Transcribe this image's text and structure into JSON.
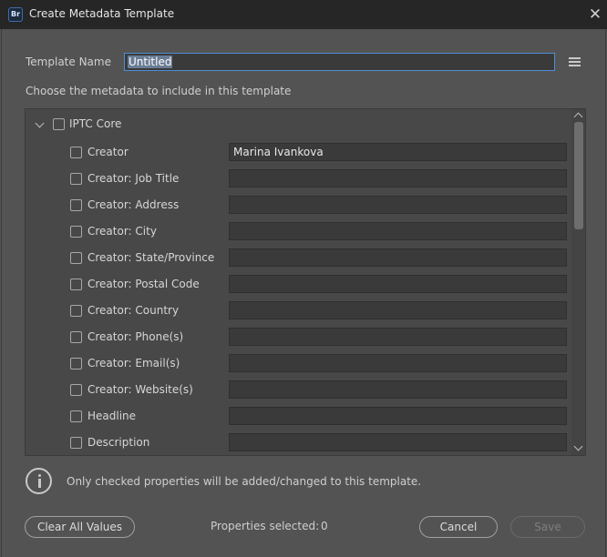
{
  "window": {
    "app_icon_text": "Br",
    "title": "Create Metadata Template",
    "close_icon": "close-icon"
  },
  "template_name": {
    "label": "Template Name",
    "value": "Untitled"
  },
  "choose_label": "Choose the metadata to include in this template",
  "metadata": {
    "group": {
      "label": "IPTC Core",
      "checked": false,
      "expanded": true
    },
    "properties": [
      {
        "label": "Creator",
        "value": "Marina Ivankova",
        "checked": false
      },
      {
        "label": "Creator: Job Title",
        "value": "",
        "checked": false
      },
      {
        "label": "Creator: Address",
        "value": "",
        "checked": false
      },
      {
        "label": "Creator: City",
        "value": "",
        "checked": false
      },
      {
        "label": "Creator: State/Province",
        "value": "",
        "checked": false
      },
      {
        "label": "Creator: Postal Code",
        "value": "",
        "checked": false
      },
      {
        "label": "Creator: Country",
        "value": "",
        "checked": false
      },
      {
        "label": "Creator: Phone(s)",
        "value": "",
        "checked": false
      },
      {
        "label": "Creator: Email(s)",
        "value": "",
        "checked": false
      },
      {
        "label": "Creator: Website(s)",
        "value": "",
        "checked": false
      },
      {
        "label": "Headline",
        "value": "",
        "checked": false
      },
      {
        "label": "Description",
        "value": "",
        "checked": false
      }
    ]
  },
  "info_text": "Only checked properties will be added/changed to this template.",
  "footer": {
    "clear_label": "Clear All Values",
    "properties_selected_label": "Properties selected:",
    "properties_selected_count": "0",
    "cancel_label": "Cancel",
    "save_label": "Save"
  },
  "colors": {
    "accent_focus": "#4d8fd6",
    "dialog_bg": "#535353",
    "titlebar_bg": "#262626"
  }
}
